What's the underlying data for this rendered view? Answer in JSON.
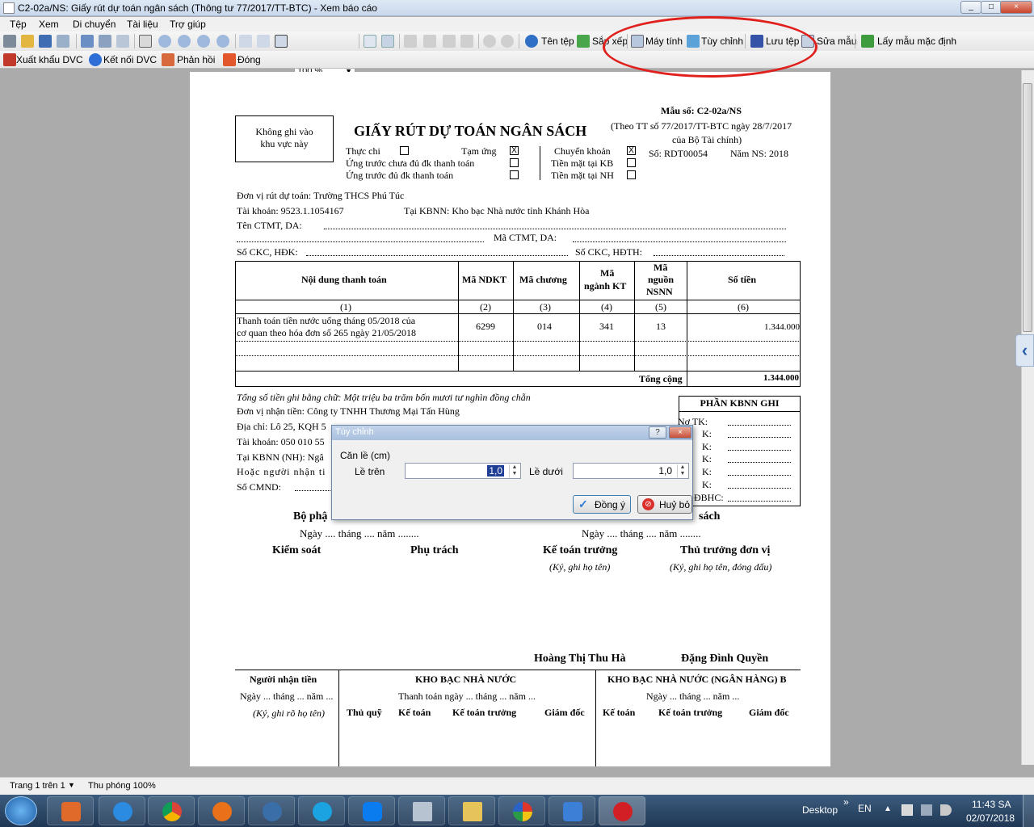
{
  "window": {
    "title": "C2-02a/NS: Giấy rút dự toán ngân sách (Thông tư 77/2017/TT-BTC) - Xem báo cáo",
    "controls": [
      "_",
      "□",
      "×"
    ]
  },
  "menu": [
    "Tệp",
    "Xem",
    "Di chuyển",
    "Tài liệu",
    "Trợ giúp"
  ],
  "toolbar": {
    "zoom": "100 %",
    "file_name_label": "Tên tệp",
    "arrange_label": "Sắp xếp",
    "calculator_label": "Máy tính",
    "customize_label": "Tùy chỉnh",
    "save_file_label": "Lưu tệp",
    "edit_template_label": "Sửa mẫu",
    "default_template_label": "Lấy mẫu mặc định",
    "export_dvc_label": "Xuất khẩu DVC",
    "connect_dvc_label": "Kết nối DVC",
    "feedback_label": "Phản hồi",
    "close_label": "Đóng"
  },
  "doc": {
    "no_write_box": "Không ghi vào khu vực này",
    "title": "GIẤY RÚT DỰ TOÁN NGÂN SÁCH",
    "form_no": "Mẫu số: C2-02a/NS",
    "circular_1": "(Theo TT số 77/2017/TT-BTC ngày 28/7/2017",
    "circular_2": "của Bộ Tài chính)",
    "opt_thuc_chi": "Thực chi",
    "opt_tam_ung": "Tạm ứng",
    "opt_ung_truoc_chua": "Ứng trước chưa đủ đk thanh toán",
    "opt_ung_truoc_du": "Ứng trước đủ đk thanh toán",
    "opt_chuyen_khoan": "Chuyển khoản",
    "opt_tm_kb": "Tiền mặt tại KB",
    "opt_tm_nh": "Tiền mặt tại NH",
    "check_mark": "X",
    "so": "Số: RDT00054",
    "nam_ns": "Năm NS: 2018",
    "don_vi": "Đơn vị rút dự toán: Trường THCS Phú Túc",
    "tai_khoan": "Tài khoản: 9523.1.1054167",
    "tai_kbnn": "Tại KBNN: Kho bạc Nhà nước tỉnh Khánh Hòa",
    "ten_ctmt": "Tên CTMT, DA:",
    "ma_ctmt": "Mã CTMT, DA:",
    "so_ckc": "Số CKC, HĐK:",
    "so_ckc_hdth": "Số CKC, HĐTH:",
    "table_headers": [
      "Nội dung thanh toán",
      "Mã NDKT",
      "Mã chương",
      "Mã ngành KT",
      "Mã nguồn NSNN",
      "Số tiền"
    ],
    "table_header_lines": {
      "ma_nganh": [
        "Mã",
        "ngành KT"
      ],
      "ma_nguon": [
        "Mã",
        "nguồn",
        "NSNN"
      ]
    },
    "table_nums": [
      "(1)",
      "(2)",
      "(3)",
      "(4)",
      "(5)",
      "(6)"
    ],
    "row": {
      "content_1": "Thanh toán tiền nước uống tháng 05/2018 của",
      "content_2": "cơ quan theo hóa đơn số 265 ngày 21/05/2018",
      "ndkt": "6299",
      "chuong": "014",
      "nganh": "341",
      "nguon": "13",
      "amount": "1.344.000"
    },
    "total_label": "Tổng cộng",
    "total": "1.344.000",
    "in_words": "Tổng số tiền ghi bằng chữ: Một triệu ba trăm bốn mươi tư nghìn đồng chẵn",
    "receiver": "Đơn vị nhận tiền: Công ty TNHH Thương Mại Tấn Hùng",
    "address": "Địa chỉ: Lô 25, KQH 5",
    "receiver_account": "Tài khoản: 050 010 55",
    "receiver_kbnn": "Tại KBNN (NH): Ngâ",
    "or_person": "Hoặc người nhận ti",
    "cmnd": "Số CMND:",
    "kbnn_box_title": "PHẦN KBNN GHI",
    "kbnn_box_rows": [
      "Nợ TK:",
      "K:",
      "K:",
      "K:",
      "K:",
      "K:",
      "ĐBHC:"
    ],
    "bo_phan": "Bộ phậ",
    "sach": "sách",
    "date_left": "Ngày .... tháng .... năm ........",
    "date_right": "Ngày .... tháng .... năm ........",
    "sig_kiem_soat": "Kiểm soát",
    "sig_phu_trach": "Phụ trách",
    "sig_ke_toan_truong": "Kế toán trưởng",
    "sig_thu_truong": "Thủ trưởng đơn vị",
    "sig_note_1": "(Ký, ghi họ tên)",
    "sig_note_2": "(Ký, ghi họ tên, đóng dấu)",
    "name_1": "Hoàng Thị Thu Hà",
    "name_2": "Đặng Đình Quyền",
    "bottom_col1_title": "Người nhận tiền",
    "bottom_col1_date": "Ngày ... tháng ... năm ...",
    "bottom_col1_note": "(Ký, ghi rõ họ tên)",
    "bottom_col2_title": "KHO BẠC NHÀ NƯỚC",
    "bottom_col2_date": "Thanh toán ngày ... tháng ... năm ...",
    "bottom_col2_roles": [
      "Thủ quỹ",
      "Kế toán",
      "Kế toán trưởng",
      "Giám đốc"
    ],
    "bottom_col3_title": "KHO BẠC NHÀ NƯỚC (NGÂN HÀNG) B",
    "bottom_col3_date": "Ngày ... tháng ... năm ...",
    "bottom_col3_roles": [
      "Kế toán",
      "Kế toán trưởng",
      "Giám đốc"
    ]
  },
  "dialog": {
    "title": "Tùy chỉnh",
    "help": "?",
    "close": "×",
    "group": "Căn lề (cm)",
    "top_label": "Lề trên",
    "top_value": "1,0",
    "bottom_label": "Lề dưới",
    "bottom_value": "1,0",
    "ok": "Đồng ý",
    "cancel": "Huỷ bỏ"
  },
  "status": {
    "page": "Trang 1 trên 1",
    "zoom": "Thu phóng 100%"
  },
  "taskbar": {
    "desktop": "Desktop",
    "chevron": "»",
    "lang": "EN",
    "time": "11:43 SA",
    "date": "02/07/2018"
  },
  "colors": {
    "annotation_circle": "#e0201c",
    "accent": "#2a5faa"
  }
}
